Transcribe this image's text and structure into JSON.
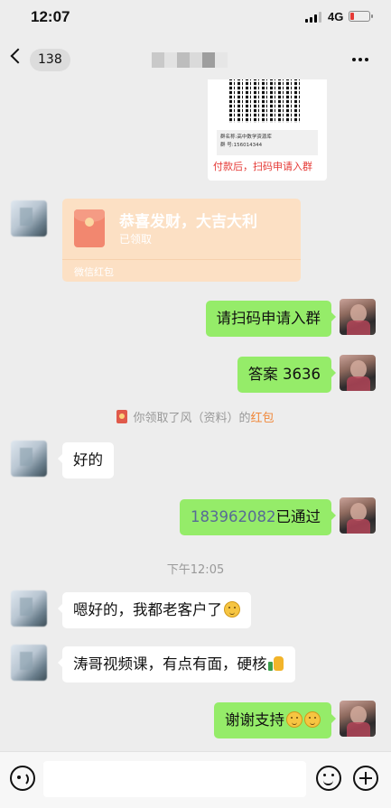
{
  "status_bar": {
    "time": "12:07",
    "network": "4G",
    "battery_level": 0.15
  },
  "nav": {
    "unread_count": "138"
  },
  "qr_card": {
    "label_line1": "群名称:高中数学资源库",
    "label_line2": "群  号:156014344",
    "caption": "付款后，扫码申请入群"
  },
  "messages": [
    {
      "type": "red_packet",
      "side": "in",
      "title": "恭喜发财，大吉大利",
      "subtitle": "已领取",
      "footer": "微信红包"
    },
    {
      "type": "text",
      "side": "out",
      "text": "请扫码申请入群"
    },
    {
      "type": "text",
      "side": "out",
      "text": "答案 3636"
    },
    {
      "type": "system",
      "prefix": "你领取了风（资料）的",
      "link": "红包"
    },
    {
      "type": "text",
      "side": "in",
      "text": "好的"
    },
    {
      "type": "text",
      "side": "out",
      "number": "183962082",
      "text": "已通过"
    },
    {
      "type": "timestamp",
      "text": "下午12:05"
    },
    {
      "type": "text",
      "side": "in",
      "text": "嗯好的，我都老客户了",
      "emoji": "thinking-face-emoji"
    },
    {
      "type": "text",
      "side": "in",
      "text": "涛哥视频课，有点有面，硬核",
      "emoji": "thumbs-up-emoji"
    },
    {
      "type": "text",
      "side": "out",
      "text": "谢谢支持",
      "emoji": "smile-emoji"
    }
  ],
  "colors": {
    "background": "#ededed",
    "bubble_out": "#95ec69",
    "bubble_in": "#ffffff",
    "red_packet": "#fce0c4",
    "link": "#576b95"
  },
  "input_bar": {
    "left_icon": "voice-icon",
    "right_icons": [
      "emoji-icon",
      "plus-icon"
    ]
  }
}
